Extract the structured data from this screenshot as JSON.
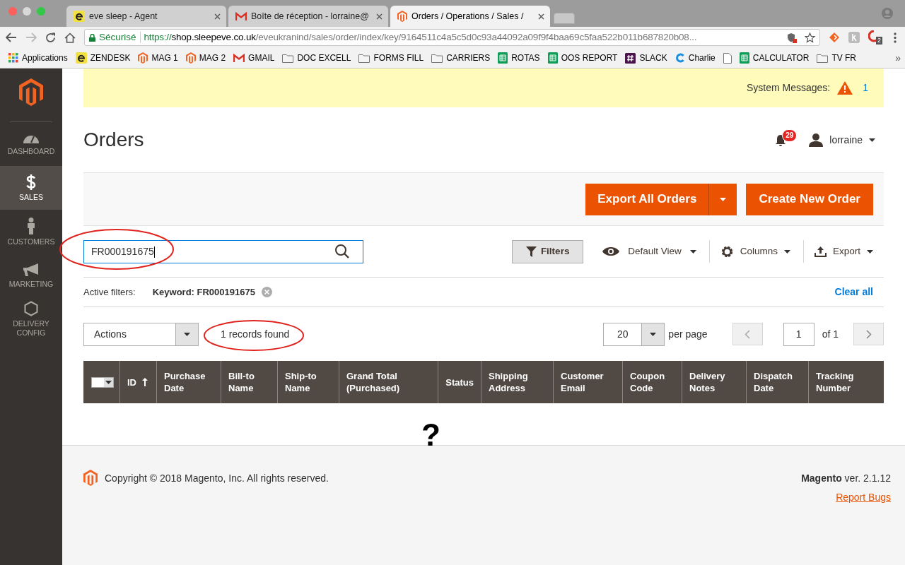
{
  "browser": {
    "tabs": [
      {
        "title": "eve sleep - Agent",
        "kind": "zendesk",
        "selected": false
      },
      {
        "title": "Boîte de réception - lorraine@",
        "kind": "gmail",
        "selected": false
      },
      {
        "title": "Orders / Operations / Sales /",
        "kind": "magento",
        "selected": true
      }
    ],
    "secure_label": "Sécurisé",
    "url_scheme": "https://",
    "url_host": "shop.sleepeve.co.uk",
    "url_path": "/eveukranind/sales/order/index/key/9164511c4a5c5d0c93a44092a09f9f4baa69c5faa522b011b687820b08...",
    "extension_badge": "2",
    "bookmarks": [
      {
        "label": "Applications",
        "kind": "apps"
      },
      {
        "label": "ZENDESK",
        "kind": "zendesk"
      },
      {
        "label": "MAG 1",
        "kind": "magento"
      },
      {
        "label": "MAG 2",
        "kind": "magento"
      },
      {
        "label": "GMAIL",
        "kind": "gmail"
      },
      {
        "label": "DOC EXCELL",
        "kind": "folder"
      },
      {
        "label": "FORMS FILL",
        "kind": "folder"
      },
      {
        "label": "CARRIERS",
        "kind": "folder"
      },
      {
        "label": "ROTAS",
        "kind": "sheet"
      },
      {
        "label": "OOS REPORT",
        "kind": "sheet"
      },
      {
        "label": "SLACK",
        "kind": "slack"
      },
      {
        "label": "Charlie",
        "kind": "charlie"
      },
      {
        "kind": "file"
      },
      {
        "label": "CALCULATOR",
        "kind": "sheet"
      },
      {
        "label": "TV FR",
        "kind": "folder"
      }
    ],
    "bookmarks_more": "»"
  },
  "sidebar": {
    "items": [
      {
        "label": "DASHBOARD",
        "kind": "dashboard",
        "selected": false
      },
      {
        "label": "SALES",
        "kind": "dollar",
        "selected": true
      },
      {
        "label": "CUSTOMERS",
        "kind": "person",
        "selected": false
      },
      {
        "label": "MARKETING",
        "kind": "megaphone",
        "selected": false
      },
      {
        "label": "DELIVERY CONFIG",
        "kind": "hexagon",
        "selected": false
      }
    ]
  },
  "system_messages": {
    "label": "System Messages:",
    "count": "1"
  },
  "header": {
    "title": "Orders",
    "notifications": "29",
    "user": "lorraine"
  },
  "actions": {
    "export_all": "Export All Orders",
    "create": "Create New Order"
  },
  "grid": {
    "search_value": "FR000191675",
    "filters": "Filters",
    "view": "Default View",
    "columns": "Columns",
    "export": "Export",
    "active_filters_label": "Active filters:",
    "active_filter": "Keyword: FR000191675",
    "clear_all": "Clear all",
    "mass_action": "Actions",
    "records_found": "1 records found",
    "per_page_value": "20",
    "per_page_label": "per page",
    "page": "1",
    "page_total": "of 1"
  },
  "table": {
    "columns": [
      {
        "label": "ID",
        "sorted": true
      },
      {
        "label": "Purchase Date",
        "sorted": false
      },
      {
        "label": "Bill-to Name",
        "sorted": false
      },
      {
        "label": "Ship-to Name",
        "sorted": false
      },
      {
        "label": "Grand Total (Purchased)",
        "sorted": false
      },
      {
        "label": "Status",
        "sorted": false
      },
      {
        "label": "Shipping Address",
        "sorted": false
      },
      {
        "label": "Customer Email",
        "sorted": false
      },
      {
        "label": "Coupon Code",
        "sorted": false
      },
      {
        "label": "Delivery Notes",
        "sorted": false
      },
      {
        "label": "Dispatch Date",
        "sorted": false
      },
      {
        "label": "Tracking Number",
        "sorted": false
      }
    ]
  },
  "annotation_mark": "?",
  "footer": {
    "copyright": "Copyright © 2018 Magento, Inc. All rights reserved.",
    "brand": "Magento",
    "version": " ver. 2.1.12",
    "report_bugs": "Report Bugs"
  }
}
